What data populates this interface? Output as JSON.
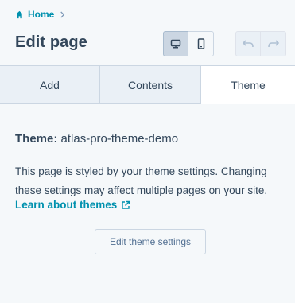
{
  "breadcrumb": {
    "home_label": "Home"
  },
  "header": {
    "title": "Edit page"
  },
  "tabs": [
    {
      "label": "Add"
    },
    {
      "label": "Contents"
    },
    {
      "label": "Theme",
      "active": true
    }
  ],
  "theme_panel": {
    "theme_label": "Theme:",
    "theme_name": "atlas-pro-theme-demo",
    "description": "This page is styled by your theme settings. Changing these settings may affect multiple pages on your site.",
    "learn_link": "Learn about themes",
    "edit_button": "Edit theme settings"
  },
  "colors": {
    "accent": "#0091ae",
    "text": "#33475b",
    "background": "#f5f8fa",
    "tab_inactive": "#eaf0f6"
  },
  "icons": [
    "home-icon",
    "chevron-right-icon",
    "desktop-icon",
    "mobile-icon",
    "undo-icon",
    "redo-icon",
    "external-link-icon"
  ]
}
